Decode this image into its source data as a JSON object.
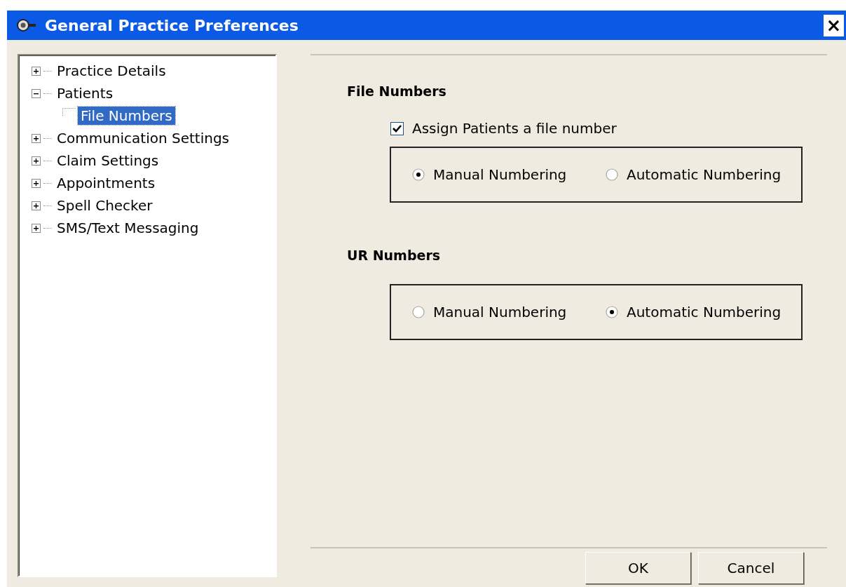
{
  "window": {
    "title": "General Practice Preferences",
    "close": "×"
  },
  "tree": [
    {
      "label": "Practice Details",
      "expanded": false,
      "selected": false
    },
    {
      "label": "Patients",
      "expanded": true,
      "selected": false,
      "children": [
        {
          "label": "File Numbers",
          "selected": true
        }
      ]
    },
    {
      "label": "Communication Settings",
      "expanded": false,
      "selected": false
    },
    {
      "label": "Claim Settings",
      "expanded": false,
      "selected": false
    },
    {
      "label": "Appointments",
      "expanded": false,
      "selected": false
    },
    {
      "label": "Spell Checker",
      "expanded": false,
      "selected": false
    },
    {
      "label": "SMS/Text Messaging",
      "expanded": false,
      "selected": false
    }
  ],
  "sections": [
    {
      "heading": "File Numbers",
      "checkbox": {
        "label": "Assign Patients a file number",
        "checked": true
      },
      "options": [
        {
          "label": "Manual Numbering",
          "selected": true
        },
        {
          "label": "Automatic Numbering",
          "selected": false
        }
      ]
    },
    {
      "heading": "UR Numbers",
      "options": [
        {
          "label": "Manual Numbering",
          "selected": false
        },
        {
          "label": "Automatic Numbering",
          "selected": true
        }
      ]
    }
  ],
  "buttons": [
    "OK",
    "Cancel"
  ]
}
